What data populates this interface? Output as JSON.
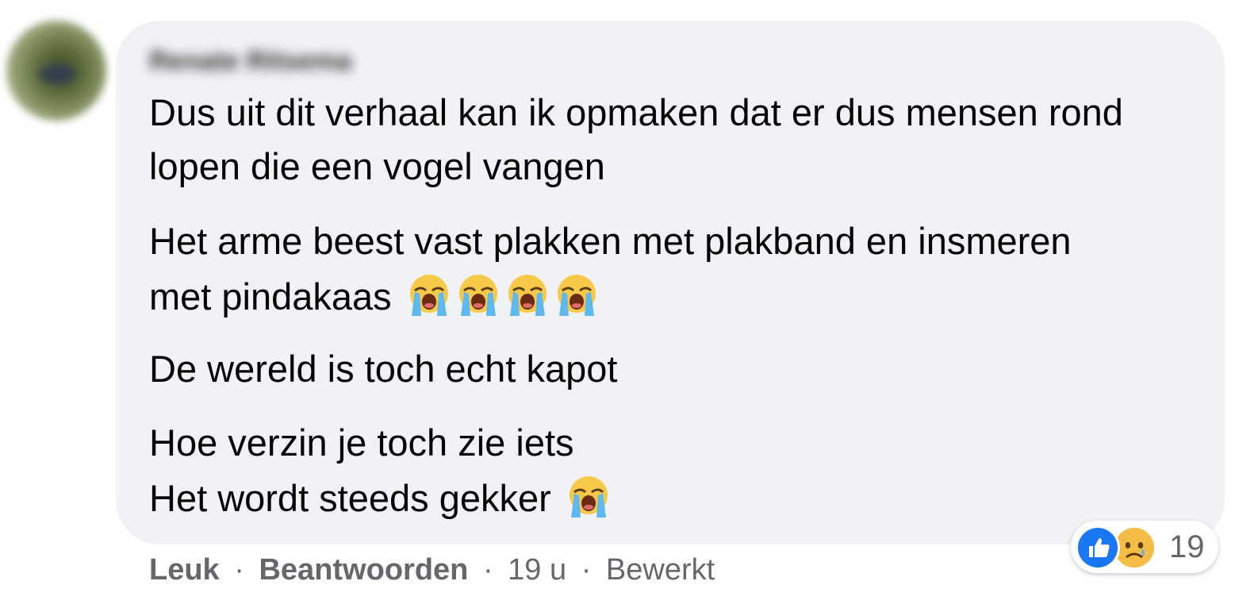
{
  "comment": {
    "author_name": "Renate Ritsema",
    "paragraphs": [
      "Dus uit dit verhaal kan ik opmaken dat er dus mensen rond",
      "lopen die een vogel vangen",
      "Het arme beest vast plakken met plakband en insmeren",
      "met pindakaas",
      "De wereld is toch echt kapot",
      "Hoe verzin je toch zie iets",
      "Het wordt steeds gekker"
    ],
    "emoji_icon": "loudly-crying-face-icon"
  },
  "actions": {
    "like_label": "Leuk",
    "separator": "·",
    "reply_label": "Beantwoorden",
    "time": "19 u",
    "edited": "Bewerkt"
  },
  "reactions": {
    "icons": [
      "like-icon",
      "sad-face-icon"
    ],
    "count": "19",
    "like_color": "#1877f2"
  },
  "colors": {
    "bubble": "#f0f2f5",
    "text": "#050505",
    "meta": "#65676b"
  }
}
